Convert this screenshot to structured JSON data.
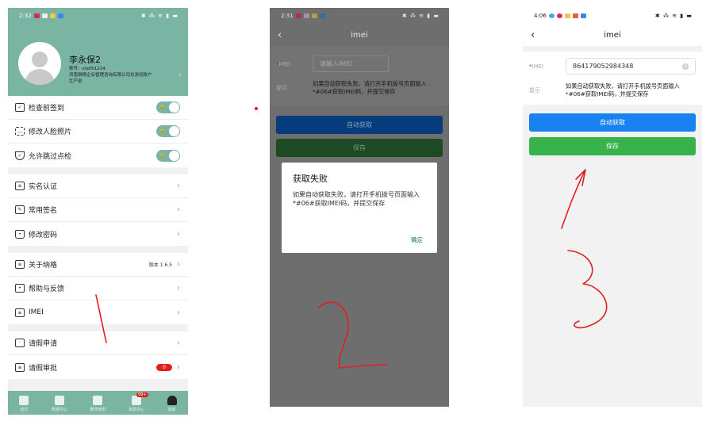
{
  "screen1": {
    "status": {
      "time": "2:32",
      "right": "✱ ⁂ ≋ ▮ ▬"
    },
    "profile": {
      "name": "李永保2",
      "account": "账号：staffli1234",
      "org": "河南钢根企业管理咨询有限公司总测试账户",
      "dept": "生产部"
    },
    "toggles": [
      {
        "label": "检查前签到",
        "lock": "🔒"
      },
      {
        "label": "修改人脸照片",
        "lock": "🔒"
      },
      {
        "label": "允许跳过点检",
        "lock": "🔒"
      }
    ],
    "menu_group_1": [
      "实名认证",
      "常用签名",
      "修改密码"
    ],
    "menu_group_2": [
      {
        "label": "关于纳格",
        "value": "版本 1.6.5"
      },
      {
        "label": "帮助与反馈",
        "value": ""
      },
      {
        "label": "IMEI",
        "value": ""
      }
    ],
    "menu_group_3": [
      {
        "label": "请假申请",
        "badge": ""
      },
      {
        "label": "请假审批",
        "badge": "0"
      }
    ],
    "tabs": [
      {
        "label": "首页",
        "badge": ""
      },
      {
        "label": "数据中心",
        "badge": ""
      },
      {
        "label": "教育培训",
        "badge": ""
      },
      {
        "label": "消息中心",
        "badge": "99+"
      },
      {
        "label": "我的",
        "badge": ""
      }
    ]
  },
  "screen2": {
    "status": {
      "time": "2:31",
      "right": "✱ ⁂ ≋ ▮ ▬"
    },
    "title": "imei",
    "imei_label": "IMEI",
    "imei_placeholder": "请输入IMEI",
    "hint_label": "提示",
    "hint_text": "如果自动获取失败，请打开手机拨号页面输入*#06#获取IMEI码，并提交保存",
    "auto_button": "自动获取",
    "save_button": "保存",
    "dialog": {
      "title": "获取失败",
      "message": "如果自动获取失败，请打开手机拨号页面输入*#06#获取IMEI码，并提交保存",
      "ok": "确定"
    }
  },
  "screen3": {
    "status": {
      "time": "4:06",
      "right": "✱ ⁂ ≋ ▮ ▬"
    },
    "title": "imei",
    "imei_label": "IMEI",
    "imei_value": "864179052984348",
    "hint_label": "提示",
    "hint_text": "如果自动获取失败，请打开手机拨号页面输入*#06#获取IMEI码，并提交保存",
    "auto_button": "自动获取",
    "save_button": "保存"
  },
  "colors": {
    "brand_green": "#7ab4a2",
    "blue_button": "#1982f2",
    "green_button": "#36b44a",
    "badge_red": "#e02020",
    "annotation_red": "#e02020"
  }
}
